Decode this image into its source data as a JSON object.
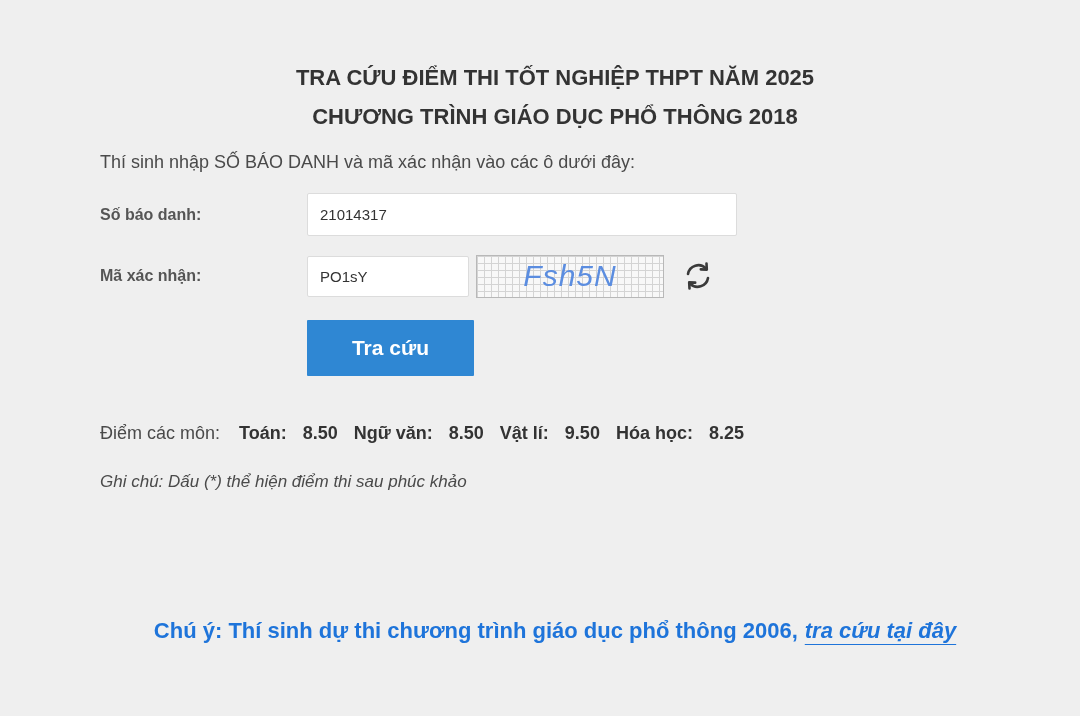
{
  "heading": {
    "lines": [
      "TRA CỨU ĐIỂM THI TỐT NGHIỆP THPT NĂM 2025",
      "CHƯƠNG TRÌNH GIÁO DỤC PHỔ THÔNG 2018"
    ]
  },
  "instruction": "Thí sinh nhập SỐ BÁO DANH và mã xác nhận vào các ô dưới đây:",
  "form": {
    "fields": [
      {
        "kind": "text",
        "label": "Số báo danh:",
        "value": "21014317"
      },
      {
        "kind": "captcha",
        "label": "Mã xác nhận:",
        "value": "PO1sY",
        "captcha_text": "Fsh5N"
      }
    ],
    "submit": "Tra cứu"
  },
  "scores": {
    "label": "Điểm các môn:",
    "subjects": [
      {
        "name": "Toán:",
        "score": "8.50"
      },
      {
        "name": "Ngữ văn:",
        "score": "8.50"
      },
      {
        "name": "Vật lí:",
        "score": "9.50"
      },
      {
        "name": "Hóa học:",
        "score": "8.25"
      }
    ]
  },
  "note": "Ghi chú: Dấu (*) thể hiện điểm thi sau phúc khảo",
  "notice": {
    "text": "Chú ý: Thí sinh dự thi chương trình giáo dục phổ thông 2006,",
    "link": "tra cứu tại đây"
  }
}
